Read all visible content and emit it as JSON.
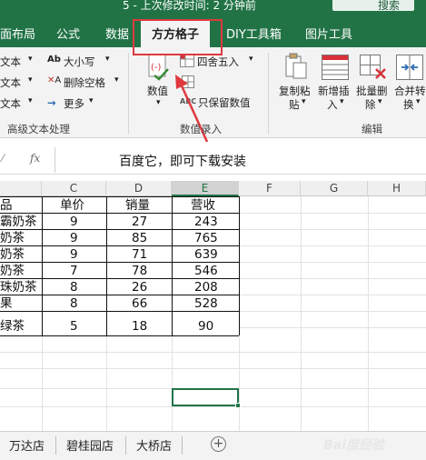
{
  "window": {
    "title": "5 - 上次修改时间: 2 分钟前",
    "search_label": "搜索"
  },
  "tabs": [
    {
      "label": "面布局"
    },
    {
      "label": "公式"
    },
    {
      "label": "数据"
    },
    {
      "label": "方方格子",
      "active": true
    },
    {
      "label": "DIY工具箱"
    },
    {
      "label": "图片工具"
    }
  ],
  "ribbon": {
    "text_group": {
      "items": [
        "文本",
        "文本",
        "文本"
      ],
      "case_label": "大小写",
      "remove_space_label": "删除空格",
      "more_label": "更多",
      "group_label": "高级文本处理"
    },
    "numeric_group": {
      "numeric_label": "数值",
      "round_label": "四舍五入",
      "keep_value_label": "只保留数值",
      "group_label": "数值录入"
    },
    "edit_group": {
      "copy_paste_label": [
        "复制粘",
        "贴"
      ],
      "insert_label": [
        "新增插",
        "入"
      ],
      "batch_delete_label": [
        "批量删",
        "除"
      ],
      "merge_label": [
        "合并转",
        "换"
      ],
      "group_label": "编辑"
    }
  },
  "formula_bar": {
    "fx_label": "fx",
    "content": "百度它，即可下载安装"
  },
  "columns": [
    "C",
    "D",
    "E",
    "F",
    "G",
    "H"
  ],
  "table": {
    "headers": [
      "品",
      "单价",
      "销量",
      "营收"
    ],
    "rows": [
      {
        "product": "霸奶茶",
        "price": "9",
        "qty": "27",
        "revenue": "243"
      },
      {
        "product": "奶茶",
        "price": "9",
        "qty": "85",
        "revenue": "765"
      },
      {
        "product": "奶茶",
        "price": "9",
        "qty": "71",
        "revenue": "639"
      },
      {
        "product": "奶茶",
        "price": "7",
        "qty": "78",
        "revenue": "546"
      },
      {
        "product": "珠奶茶",
        "price": "8",
        "qty": "26",
        "revenue": "208"
      },
      {
        "product": "果",
        "price": "8",
        "qty": "66",
        "revenue": "528"
      },
      {
        "product": "绿茶",
        "price": "5",
        "qty": "18",
        "revenue": "90"
      }
    ]
  },
  "sheets": [
    {
      "label": "万达店"
    },
    {
      "label": "碧桂园店"
    },
    {
      "label": "大桥店"
    }
  ],
  "add_sheet": "+",
  "watermark": "Bai度经验",
  "colors": {
    "accent": "#217346",
    "highlight": "#e0393e"
  }
}
